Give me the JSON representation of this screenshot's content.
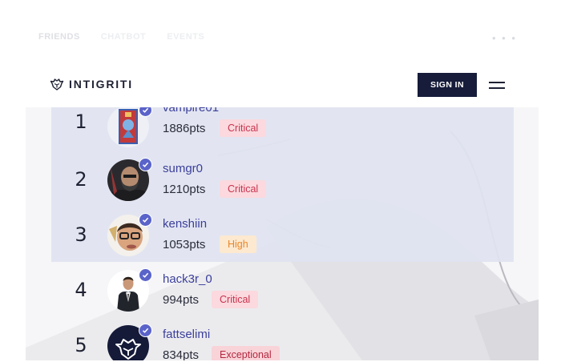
{
  "ghost_tabs": [
    "FRIENDS",
    "CHATBOT",
    "EVENTS"
  ],
  "ghost_menu": "• • •",
  "header": {
    "brand": "INTIGRITI",
    "signin_label": "SIGN IN"
  },
  "leaderboard": [
    {
      "rank": "1",
      "username": "vampire01",
      "points": "1886pts",
      "severity": "Critical"
    },
    {
      "rank": "2",
      "username": "sumgr0",
      "points": "1210pts",
      "severity": "Critical"
    },
    {
      "rank": "3",
      "username": "kenshiin",
      "points": "1053pts",
      "severity": "High"
    },
    {
      "rank": "4",
      "username": "hack3r_0",
      "points": "994pts",
      "severity": "Critical"
    },
    {
      "rank": "5",
      "username": "fattselimi",
      "points": "834pts",
      "severity": "Exceptional"
    }
  ],
  "colors": {
    "brand_dark": "#161c3a",
    "link": "#3b3f9a",
    "verified": "#5a63c9",
    "critical": "#c8334e",
    "high": "#e8862a",
    "highlight": "#e0e3f0"
  }
}
